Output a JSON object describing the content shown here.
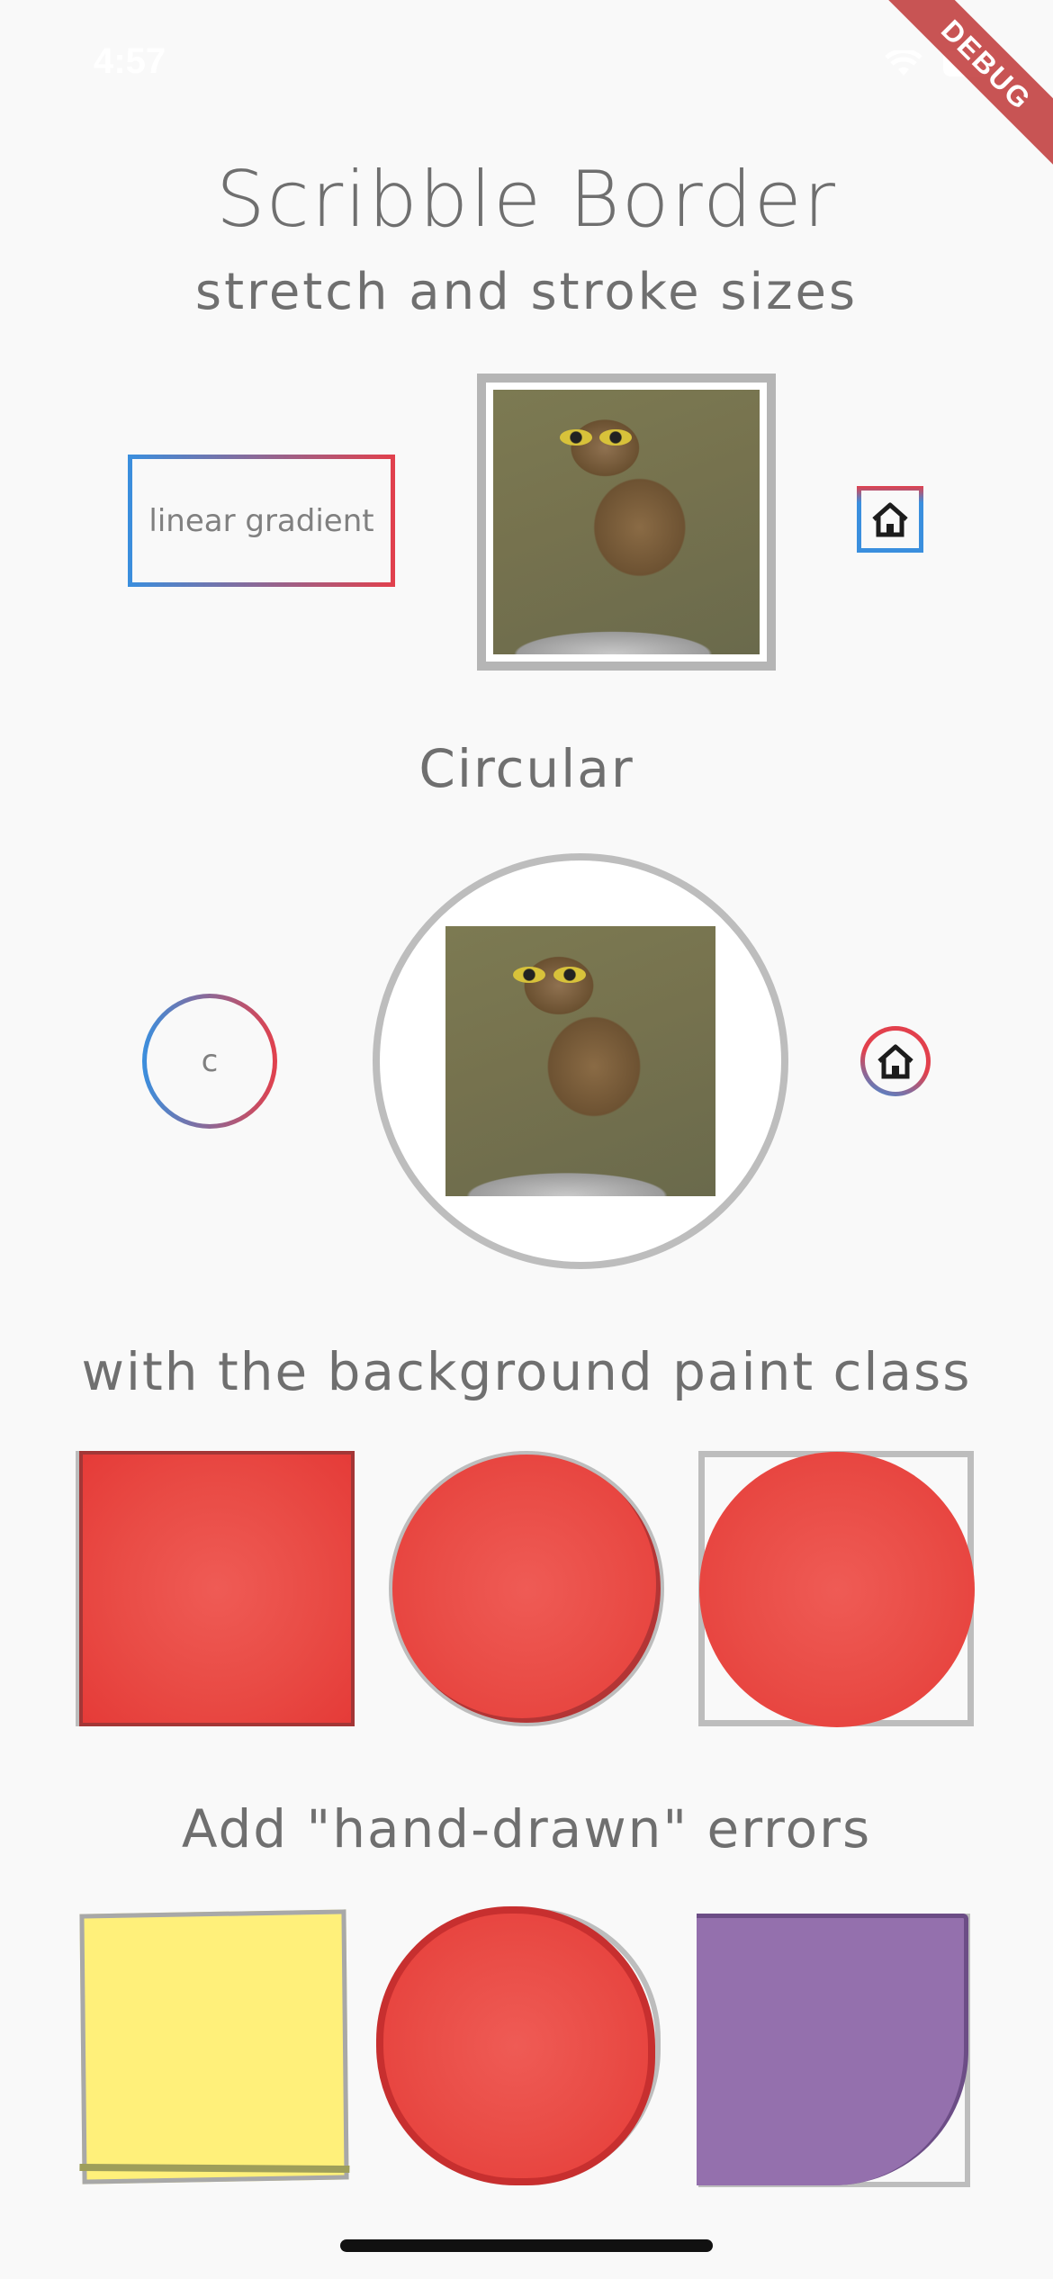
{
  "status_bar": {
    "time": "4:57",
    "icons": [
      "wifi-icon",
      "battery-icon"
    ]
  },
  "debug_banner": "DEBUG",
  "title": "Scribble Border",
  "subtitle": "stretch and stroke sizes",
  "row1": {
    "gradient_box_label": "linear gradient",
    "image": "owl-photo",
    "icon": "home-icon"
  },
  "circular_heading": "Circular",
  "row2": {
    "gradient_circle_label": "c",
    "image": "owl-photo",
    "icon": "home-icon"
  },
  "background_heading": "with the background paint class",
  "errors_heading": "Add \"hand-drawn\" errors",
  "colors": {
    "gradient_start": "#3a8fde",
    "gradient_end": "#e2404c",
    "red_fill": "#e94b45",
    "yellow_fill": "#fff07a",
    "purple_fill": "#9470ad",
    "outline_gray": "#bdbdbd",
    "text_gray": "#6f6f6f"
  }
}
